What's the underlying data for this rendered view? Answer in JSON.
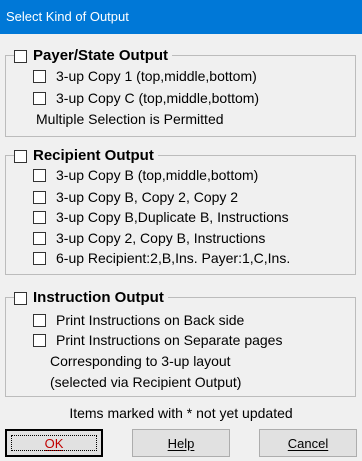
{
  "window": {
    "title": "Select Kind of Output"
  },
  "payer_group": {
    "label": "Payer/State Output",
    "options": [
      "3-up Copy 1 (top,middle,bottom)",
      "3-up Copy C (top,middle,bottom)"
    ],
    "note": "Multiple Selection is Permitted"
  },
  "recipient_group": {
    "label": "Recipient Output",
    "options": [
      "3-up Copy B (top,middle,bottom)",
      "3-up Copy B, Copy 2, Copy 2",
      "3-up Copy B,Duplicate B, Instructions",
      "3-up Copy 2, Copy B, Instructions",
      "6-up Recipient:2,B,Ins. Payer:1,C,Ins."
    ]
  },
  "instruction_group": {
    "label": "Instruction Output",
    "options": [
      "Print Instructions on Back side",
      "Print Instructions on Separate pages"
    ],
    "note_line1": "Corresponding to 3-up layout",
    "note_line2": "(selected via Recipient Output)"
  },
  "footer_note": "Items marked with * not yet updated",
  "buttons": {
    "ok": "OK",
    "help": "Help",
    "cancel": "Cancel"
  },
  "colors": {
    "titlebar": "#0078d7",
    "ok_text": "#c00000",
    "background": "#f0f0f0"
  }
}
